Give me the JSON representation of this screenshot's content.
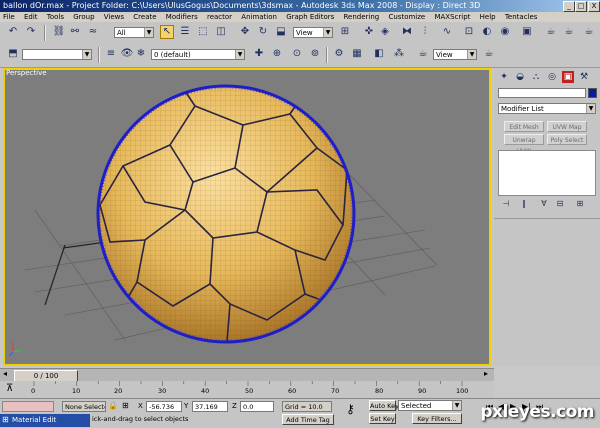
{
  "window": {
    "title": "ballon dOr.max   - Project Folder: C:\\Users\\UlusGogus\\Documents\\3dsmax   - Autodesk 3ds Max 2008   - Display : Direct 3D",
    "min": "_",
    "max": "□",
    "close": "X"
  },
  "menu": [
    "File",
    "Edit",
    "Tools",
    "Group",
    "Views",
    "Create",
    "Modifiers",
    "reactor",
    "Animation",
    "Graph Editors",
    "Rendering",
    "Customize",
    "MAXScript",
    "Help",
    "Tentacles"
  ],
  "toolbar1": {
    "filter_value": "All",
    "refcoord_value": "View"
  },
  "toolbar2": {
    "layer_value": "0 (default)",
    "view_value": "View"
  },
  "viewport": {
    "label": "Perspective"
  },
  "command_panel": {
    "name_value": "",
    "modifier_list": "Modifier List",
    "buttons": [
      "Edit Mesh",
      "UVW Map",
      "Unwrap UVW",
      "Poly Select"
    ],
    "accent": "#0a1c9c"
  },
  "time_slider": {
    "position": "0 / 100"
  },
  "trackbar": {
    "ticks": [
      "0",
      "10",
      "20",
      "30",
      "40",
      "50",
      "60",
      "70",
      "80",
      "90",
      "100"
    ]
  },
  "status": {
    "selection": "None Selecte",
    "prompt": "ick-and-drag to select objects",
    "x_label": "X",
    "x_value": "-56.736",
    "y_label": "Y",
    "y_value": "37.169",
    "z_label": "Z",
    "z_value": "0.0",
    "grid": "Grid = 10.0",
    "add_time_tag": "Add Time Tag",
    "auto_key": "Auto Key",
    "set_key": "Set Key",
    "key_mode_value": "Selected",
    "key_filters": "Key Filters...",
    "taskbar_item": "Material Edit"
  },
  "watermark": "pxleyes.com",
  "colors": {
    "viewport_bg": "#7d7d7d",
    "viewport_border": "#f0d000",
    "ball_color": "#e6b85a",
    "wire_color": "#1e1ec8"
  }
}
